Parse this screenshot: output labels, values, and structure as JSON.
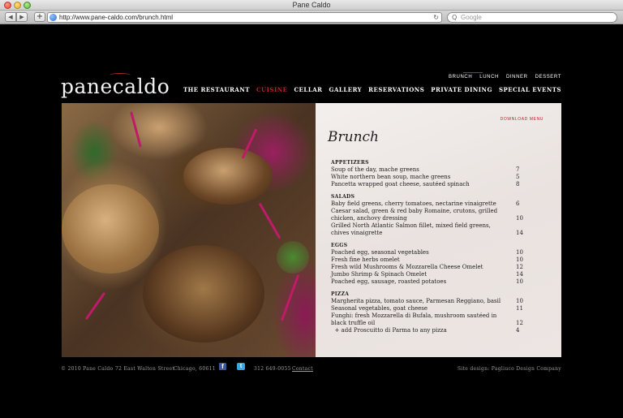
{
  "browser": {
    "window_title": "Pane Caldo",
    "url": "http://www.pane-caldo.com/brunch.html",
    "search_placeholder": "Google",
    "back_glyph": "◀",
    "forward_glyph": "▶",
    "add_glyph": "+",
    "reload_glyph": "↻",
    "search_glyph": "Q"
  },
  "site": {
    "logo": "panecaldo",
    "subnav": [
      "BRUNCH",
      "LUNCH",
      "DINNER",
      "DESSERT"
    ],
    "subnav_active": "BRUNCH",
    "mainnav": [
      "THE RESTAURANT",
      "CUISINE",
      "CELLAR",
      "GALLERY",
      "RESERVATIONS",
      "PRIVATE DINING",
      "SPECIAL EVENTS"
    ],
    "mainnav_active": "CUISINE",
    "accent_color": "#b3262b"
  },
  "menu": {
    "download_label": "DOWNLOAD MENU",
    "title": "Brunch",
    "sections": [
      {
        "title": "APPETIZERS",
        "items": [
          {
            "name": "Soup of the day, mache greens",
            "price": "7"
          },
          {
            "name": "White northern bean soup, mache greens",
            "price": "5"
          },
          {
            "name": "Pancetta wrapped goat cheese, sautéed spinach",
            "price": "8"
          }
        ]
      },
      {
        "title": "SALADS",
        "items": [
          {
            "name": "Baby field greens, cherry tomatoes, nectarine vinaigrette",
            "price": "6"
          },
          {
            "name": "Caesar salad, green & red baby Romaine, crutons, grilled chicken, anchovy dressing",
            "price": "10"
          },
          {
            "name": "Grilled North Atlantic Salmon fillet, mixed field greens, chives vinaigrette",
            "price": "14"
          }
        ]
      },
      {
        "title": "EGGS",
        "items": [
          {
            "name": "Poached egg, seasonal vegetables",
            "price": "10"
          },
          {
            "name": "Fresh fine herbs omelet",
            "price": "10"
          },
          {
            "name": "Fresh wild Mushrooms & Mozzarella Cheese Omelet",
            "price": "12"
          },
          {
            "name": "Jumbo Shrimp & Spinach Omelet",
            "price": "14"
          },
          {
            "name": "Poached egg, sausage, roasted potatoes",
            "price": "10"
          }
        ]
      },
      {
        "title": "PIZZA",
        "items": [
          {
            "name": "Margherita pizza, tomato sauce, Parmesan Reggiano, basil",
            "price": "10"
          },
          {
            "name": "Seasonal vegetables, goat cheese",
            "price": "11"
          },
          {
            "name": "Funghi: fresh Mozzarella di Bufala, mushroom sautéed in black truffle oil",
            "price": "12"
          },
          {
            "name": "  + add Proscuitto di Parma to any pizza",
            "price": "4"
          }
        ]
      }
    ]
  },
  "footer": {
    "copyright": "© 2010 Pane Caldo",
    "address": "72 East Walton Street",
    "city": "Chicago, 60611",
    "facebook_glyph": "f",
    "twitter_glyph": "t",
    "phone": "312 649-0055",
    "contact": "Contact",
    "credit": "Site design: Pagliuco Design Company"
  }
}
